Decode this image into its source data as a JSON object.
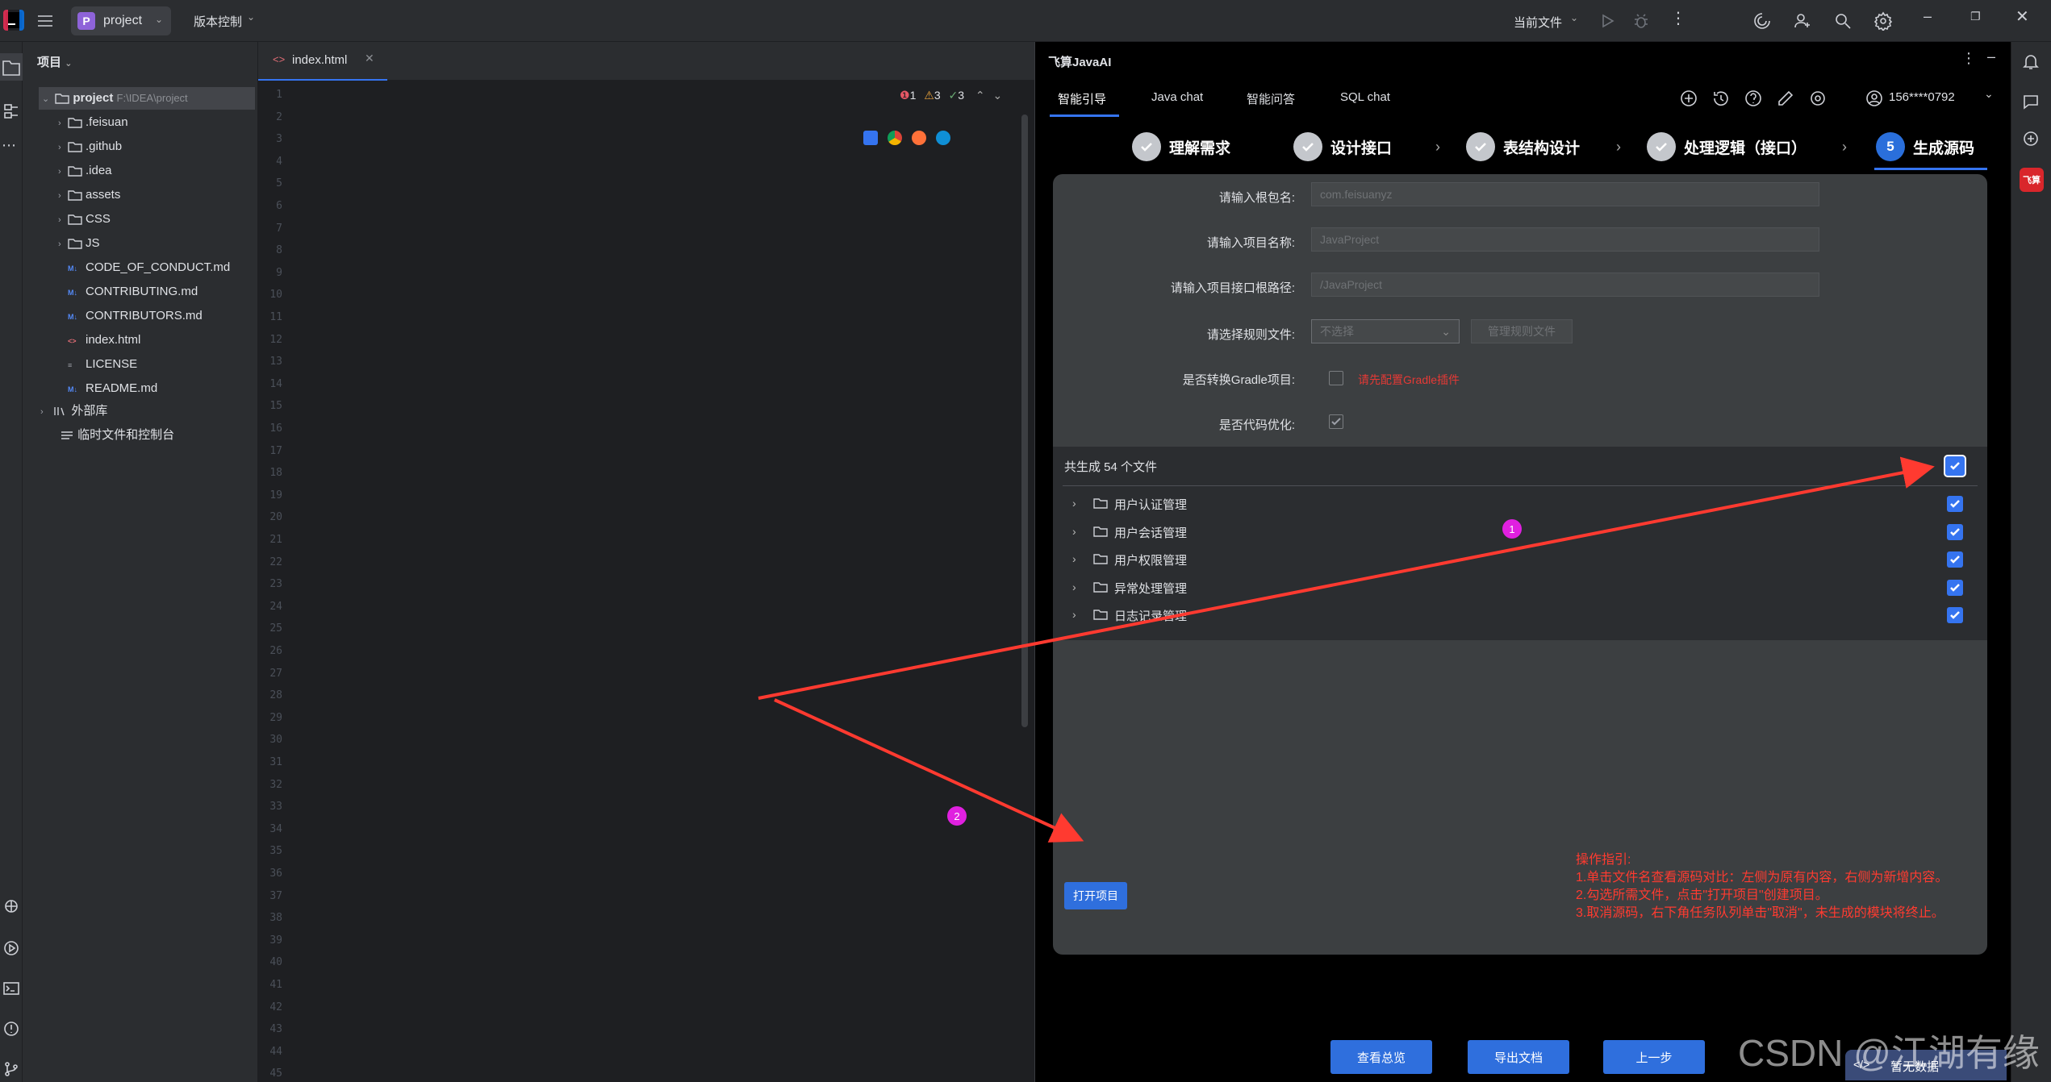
{
  "titlebar": {
    "project_label": "project",
    "project_letter": "P",
    "vcs_label": "版本控制",
    "current_file_label": "当前文件"
  },
  "project_panel": {
    "title": "项目",
    "root_name": "project",
    "root_path": "F:\\IDEA\\project",
    "items": [
      {
        "label": ".feisuan",
        "type": "folder"
      },
      {
        "label": ".github",
        "type": "folder"
      },
      {
        "label": ".idea",
        "type": "folder"
      },
      {
        "label": "assets",
        "type": "folder"
      },
      {
        "label": "CSS",
        "type": "folder"
      },
      {
        "label": "JS",
        "type": "folder"
      },
      {
        "label": "CODE_OF_CONDUCT.md",
        "type": "md",
        "tag": "M↓"
      },
      {
        "label": "CONTRIBUTING.md",
        "type": "md",
        "tag": "M↓"
      },
      {
        "label": "CONTRIBUTORS.md",
        "type": "md",
        "tag": "M↓"
      },
      {
        "label": "index.html",
        "type": "html",
        "tag": "<>"
      },
      {
        "label": "LICENSE",
        "type": "text",
        "tag": "≡"
      },
      {
        "label": "README.md",
        "type": "md",
        "tag": "M↓"
      }
    ],
    "external_libs": "外部库",
    "scratches": "临时文件和控制台"
  },
  "editor": {
    "tab_label": "index.html",
    "errors": "1",
    "warnings": "3",
    "ok": "3",
    "line_numbers": [
      "1",
      "2",
      "3",
      "4",
      "5",
      "6",
      "7",
      "8",
      "9",
      "10",
      "11",
      "12",
      "13",
      "14",
      "15",
      "16",
      "17",
      "18",
      "19",
      "20",
      "21",
      "22",
      "23",
      "24",
      "25",
      "26",
      "27",
      "28",
      "29",
      "30",
      "31",
      "32",
      "33",
      "34",
      "35",
      "36",
      "37",
      "38",
      "39",
      "40",
      "41",
      "42",
      "43",
      "44",
      "45"
    ]
  },
  "ai_panel": {
    "title": "飞算JavaAI",
    "tabs": [
      "智能引导",
      "Java chat",
      "智能问答",
      "SQL chat"
    ],
    "user": "156****0792",
    "steps": [
      {
        "label": "理解需求",
        "done": true
      },
      {
        "label": "设计接口",
        "done": true
      },
      {
        "label": "表结构设计",
        "done": true
      },
      {
        "label": "处理逻辑（接口）",
        "done": true
      },
      {
        "label": "生成源码",
        "num": "5"
      }
    ],
    "form": {
      "package_label": "请输入根包名:",
      "package_placeholder": "com.feisuanyz",
      "project_label": "请输入项目名称:",
      "project_placeholder": "JavaProject",
      "path_label": "请输入项目接口根路径:",
      "path_placeholder": "/JavaProject",
      "rule_label": "请选择规则文件:",
      "rule_select": "不选择",
      "rule_manage": "管理规则文件",
      "gradle_label": "是否转换Gradle项目:",
      "gradle_warn": "请先配置Gradle插件",
      "optimize_label": "是否代码优化:"
    },
    "files_summary": "共生成 54 个文件",
    "file_groups": [
      "用户认证管理",
      "用户会话管理",
      "用户权限管理",
      "异常处理管理",
      "日志记录管理"
    ],
    "open_button": "打开项目",
    "guide": [
      "操作指引:",
      "1.单击文件名查看源码对比：左侧为原有内容，右侧为新增内容。",
      "2.勾选所需文件，点击\"打开项目\"创建项目。",
      "3.取消源码，右下角任务队列单击\"取消\"，未生成的模块将终止。"
    ],
    "bottom_buttons": [
      "查看总览",
      "导出文档",
      "上一步"
    ],
    "no_data": "暂无数据",
    "badges": [
      "1",
      "2"
    ]
  },
  "watermark": "CSDN @江湖有缘",
  "rstrip_label": "飞算"
}
